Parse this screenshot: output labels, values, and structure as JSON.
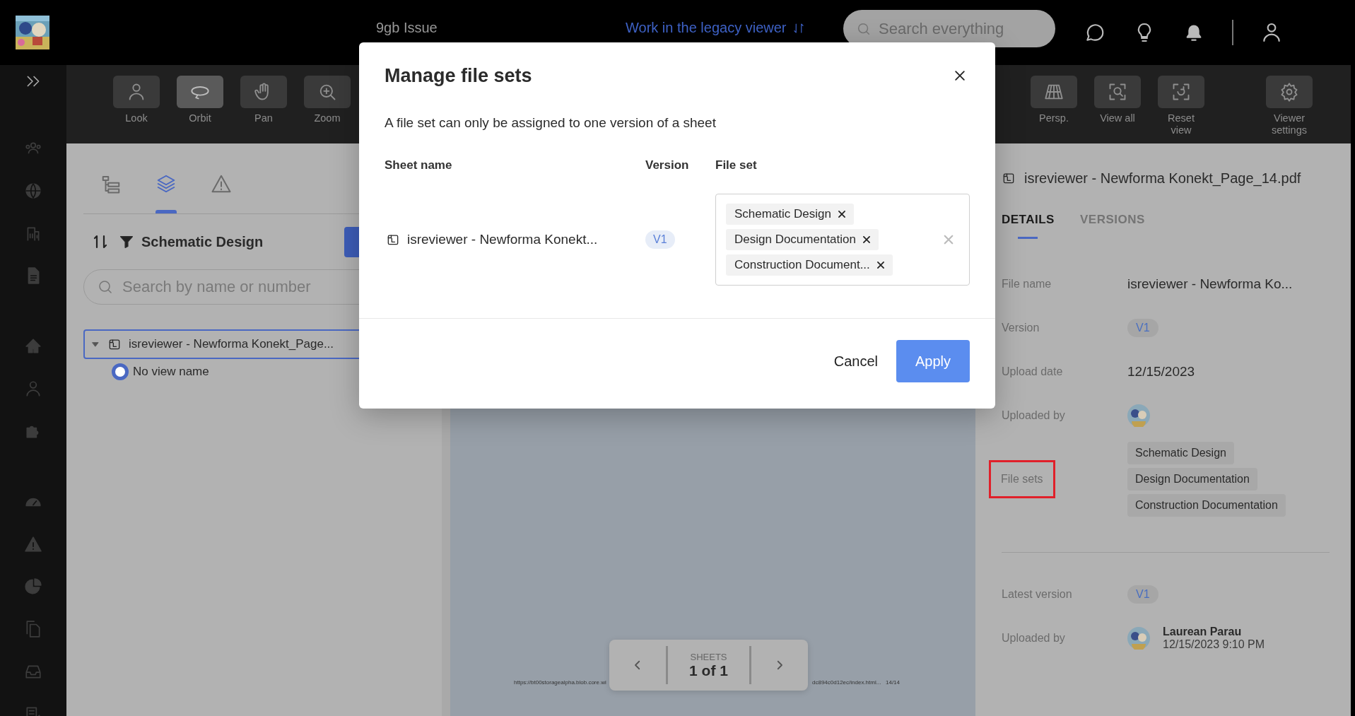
{
  "top_bar": {
    "title": "9gb Issue",
    "legacy_link": "Work in the legacy viewer",
    "search": {
      "placeholder": "Search everything"
    }
  },
  "toolbar": {
    "left_tools": [
      {
        "label": "Look",
        "selected": false
      },
      {
        "label": "Orbit",
        "selected": true
      },
      {
        "label": "Pan",
        "selected": false
      },
      {
        "label": "Zoom",
        "selected": false
      }
    ],
    "right_tools": [
      {
        "label": "Persp.",
        "selected": false
      },
      {
        "label": "View all",
        "selected": false
      },
      {
        "label": "Reset view",
        "selected": false
      },
      {
        "label": "Viewer settings",
        "selected": false
      }
    ]
  },
  "sheet_panel": {
    "tabs": [
      {
        "selected": false
      },
      {
        "selected": true
      },
      {
        "selected": false
      }
    ],
    "filter": "Schematic Design",
    "search": {
      "placeholder": "Search by name or number"
    },
    "tree": [
      {
        "label": "isreviewer - Newforma Konekt_Page...",
        "expanded": true,
        "selected": true,
        "children": [
          {
            "label": "No view name",
            "selected": true
          }
        ]
      }
    ]
  },
  "viewer": {
    "footer_url_start": "https://bt00storagealpha.blob.core.wi",
    "footer_url_end": "dc894c0d12ec/index.html...",
    "footer_page": "14/14",
    "pager": {
      "caption": "SHEETS",
      "value": "1 of 1"
    }
  },
  "details_panel": {
    "title": "isreviewer - Newforma Konekt_Page_14.pdf",
    "tabs": [
      {
        "label": "DETAILS",
        "selected": true
      },
      {
        "label": "VERSIONS",
        "selected": false
      }
    ],
    "fields": [
      {
        "kind": "text",
        "label": "File name",
        "value": "isreviewer - Newforma Ko...",
        "highlighted": false
      },
      {
        "kind": "badge",
        "label": "Version",
        "value": "V1",
        "highlighted": false
      },
      {
        "kind": "text",
        "label": "Upload date",
        "value": "12/15/2023",
        "highlighted": false
      },
      {
        "kind": "avatar",
        "label": "Uploaded by",
        "highlighted": false
      },
      {
        "kind": "tags",
        "label": "File sets",
        "tags": [
          "Schematic Design",
          "Design Documentation",
          "Construction Documentation"
        ],
        "highlighted": true
      }
    ],
    "latest": [
      {
        "kind": "badge",
        "label": "Latest version",
        "value": "V1"
      },
      {
        "kind": "user",
        "label": "Uploaded by",
        "name": "Laurean Parau",
        "time": "12/15/2023 9:10 PM"
      }
    ]
  },
  "dialog": {
    "title": "Manage file sets",
    "description": "A file set can only be assigned to one version of a sheet",
    "columns": [
      "Sheet name",
      "Version",
      "File set"
    ],
    "rows": [
      {
        "sheet": "isreviewer - Newforma Konekt...",
        "version": "V1",
        "file_sets": [
          "Schematic Design",
          "Design Documentation",
          "Construction Document..."
        ]
      }
    ],
    "buttons": [
      {
        "label": "Cancel",
        "kind": "secondary"
      },
      {
        "label": "Apply",
        "kind": "primary"
      }
    ]
  }
}
